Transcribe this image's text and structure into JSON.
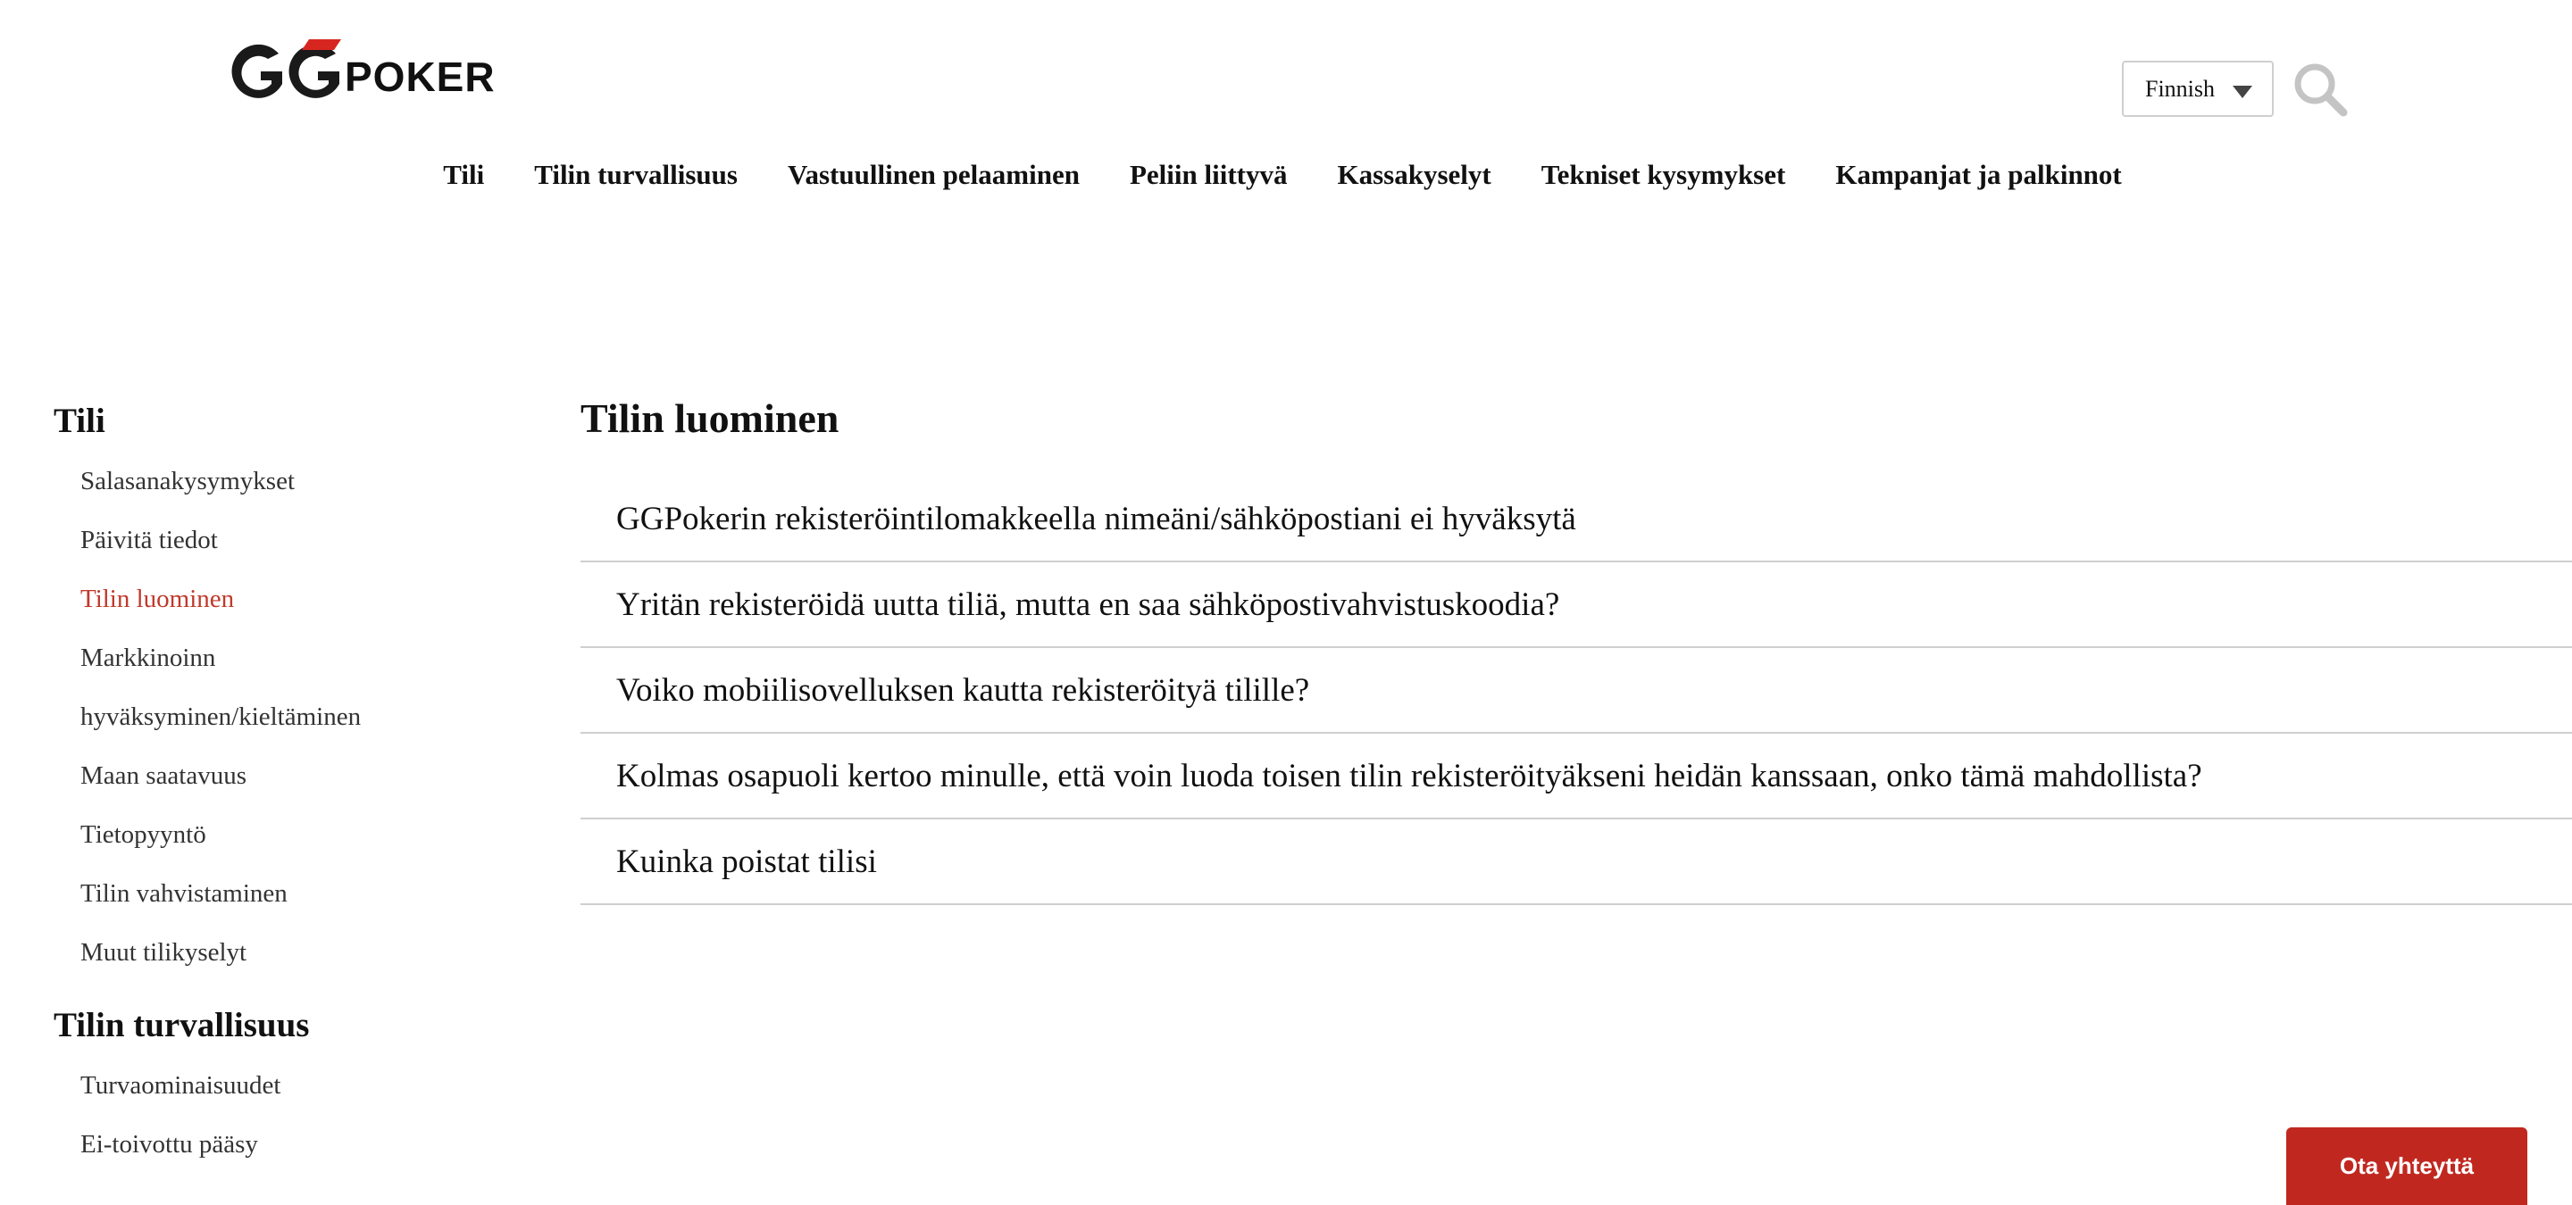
{
  "brand": {
    "logo_text": "POKER",
    "accent": "#c0281f"
  },
  "header": {
    "language": {
      "selected": "Finnish"
    },
    "search_icon": "search-icon"
  },
  "nav": {
    "items": [
      "Tili",
      "Tilin turvallisuus",
      "Vastuullinen pelaaminen",
      "Peliin liittyvä",
      "Kassakyselyt",
      "Tekniset kysymykset",
      "Kampanjat ja palkinnot"
    ]
  },
  "sidebar": {
    "sections": [
      {
        "heading": "Tili",
        "items": [
          "Salasanakysymykset",
          "Päivitä tiedot",
          "Tilin luominen",
          "Markkinoinn",
          "hyväksyminen/kieltäminen",
          "Maan saatavuus",
          "Tietopyyntö",
          "Tilin vahvistaminen",
          "Muut tilikyselyt"
        ],
        "active_index": 2
      },
      {
        "heading": "Tilin turvallisuus",
        "items": [
          "Turvaominaisuudet",
          "Ei-toivottu pääsy"
        ]
      }
    ],
    "active_color": "#c0392b"
  },
  "main": {
    "title": "Tilin luominen",
    "faq": [
      "GGPokerin rekisteröintilomakkeella nimeäni/sähköpostiani ei hyväksytä",
      "Yritän rekisteröidä uutta tiliä, mutta en saa sähköpostivahvistuskoodia?",
      "Voiko mobiilisovelluksen kautta rekisteröityä tilille?",
      "Kolmas osapuoli kertoo minulle, että voin luoda toisen tilin rekisteröityäkseni heidän kanssaan, onko tämä mahdollista?",
      "Kuinka poistat tilisi"
    ]
  },
  "contact": {
    "label": "Ota yhteyttä"
  }
}
